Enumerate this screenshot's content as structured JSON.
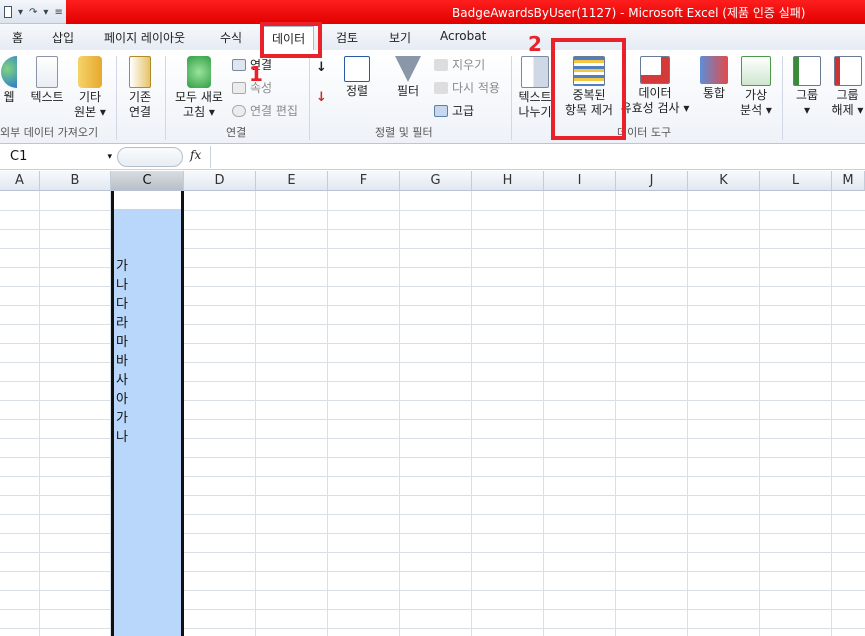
{
  "window": {
    "title": "BadgeAwardsByUser(1127)  -  Microsoft Excel (제품 인증 실패)",
    "qat_undo": "▾",
    "qat_redo": "▾"
  },
  "tabs": [
    {
      "label": "홈"
    },
    {
      "label": "삽입"
    },
    {
      "label": "페이지 레이아웃"
    },
    {
      "label": "수식"
    },
    {
      "label": "데이터",
      "active": true
    },
    {
      "label": "검토"
    },
    {
      "label": "보기"
    },
    {
      "label": "Acrobat"
    }
  ],
  "ribbon": {
    "external": {
      "web": "웹",
      "text": "텍스트",
      "other1": "기타",
      "other2": "원본 ▾",
      "label": "외부 데이터 가져오기"
    },
    "existing": {
      "line1": "기존",
      "line2": "연결"
    },
    "connections": {
      "refresh1": "모두 새로",
      "refresh2": "고침 ▾",
      "connections": "연결",
      "properties": "속성",
      "edit_links": "연결 편집",
      "label": "연결"
    },
    "sort": {
      "sort": "정렬",
      "az": "가",
      "za": "하",
      "filter": "필터",
      "clear": "지우기",
      "reapply": "다시 적용",
      "advanced": "고급",
      "label": "정렬 및 필터"
    },
    "tools": {
      "text_to_col1": "텍스트",
      "text_to_col2": "나누기",
      "remove_dup1": "중복된",
      "remove_dup2": "항목 제거",
      "validation1": "데이터",
      "validation2": "유효성 검사 ▾",
      "consolidate": "통합",
      "whatif1": "가상",
      "whatif2": "분석 ▾",
      "label": "데이터 도구"
    },
    "outline": {
      "group": "그룹",
      "group_arrow": "▾",
      "ungroup1": "그룹",
      "ungroup2": "해제 ▾"
    }
  },
  "annotations": {
    "step1": "1",
    "step2": "2"
  },
  "formula_bar": {
    "name_box": "C1",
    "name_arrow": "▾",
    "fx": "fx",
    "value": ""
  },
  "columns": [
    "A",
    "B",
    "C",
    "D",
    "E",
    "F",
    "G",
    "H",
    "I",
    "J",
    "K",
    "L",
    "M"
  ],
  "selected_column": "C",
  "cells_c": [
    "",
    "",
    "",
    "가",
    "나",
    "다",
    "라",
    "마",
    "바",
    "사",
    "아",
    "가",
    "나"
  ],
  "colors": {
    "accent_red": "#e8212b",
    "selection_blue": "#b8d7fa"
  }
}
